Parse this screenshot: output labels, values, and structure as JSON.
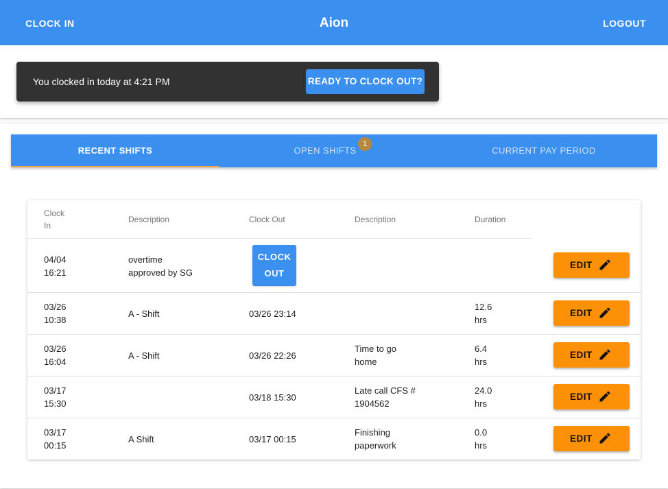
{
  "appbar": {
    "clock_in_label": "CLOCK IN",
    "title": "Aion",
    "logout_label": "LOGOUT",
    "color": "#3b8fef"
  },
  "snackbar": {
    "message": "You clocked in today at 4:21 PM",
    "action_label": "READY TO CLOCK OUT?"
  },
  "tabs": {
    "items": [
      {
        "label": "RECENT SHIFTS",
        "active": true
      },
      {
        "label": "OPEN SHIFTS",
        "badge": "1"
      },
      {
        "label": "CURRENT PAY PERIOD"
      }
    ],
    "indicator_color": "#f4a340"
  },
  "table": {
    "headers": {
      "clock_in_1": "Clock",
      "clock_in_2": "In",
      "description": "Description",
      "clock_out": "Clock Out",
      "out_description": "Description",
      "duration": "Duration"
    },
    "clock_out_button": {
      "line1": "CLOCK",
      "line2": "OUT"
    },
    "edit_label": "EDIT",
    "edit_icon": "pencil-icon",
    "rows": [
      {
        "in_date": "04/04",
        "in_time": "16:21",
        "desc1": "overtime",
        "desc2": "approved by SG",
        "clock_out": "",
        "out_desc1": "",
        "out_desc2": "",
        "dur1": "",
        "dur2": ""
      },
      {
        "in_date": "03/26",
        "in_time": "10:38",
        "desc1": "A - Shift",
        "desc2": "",
        "clock_out": "03/26 23:14",
        "out_desc1": "",
        "out_desc2": "",
        "dur1": "12.6",
        "dur2": "hrs"
      },
      {
        "in_date": "03/26",
        "in_time": "16:04",
        "desc1": "A - Shift",
        "desc2": "",
        "clock_out": "03/26 22:26",
        "out_desc1": "Time to go",
        "out_desc2": "home",
        "dur1": "6.4",
        "dur2": "hrs"
      },
      {
        "in_date": "03/17",
        "in_time": "15:30",
        "desc1": "",
        "desc2": "",
        "clock_out": "03/18 15:30",
        "out_desc1": "Late call CFS #",
        "out_desc2": "1904562",
        "dur1": "24.0",
        "dur2": "hrs"
      },
      {
        "in_date": "03/17",
        "in_time": "00:15",
        "desc1": "A Shift",
        "desc2": "",
        "clock_out": "03/17 00:15",
        "out_desc1": "Finishing",
        "out_desc2": "paperwork",
        "dur1": "0.0",
        "dur2": "hrs"
      }
    ]
  }
}
